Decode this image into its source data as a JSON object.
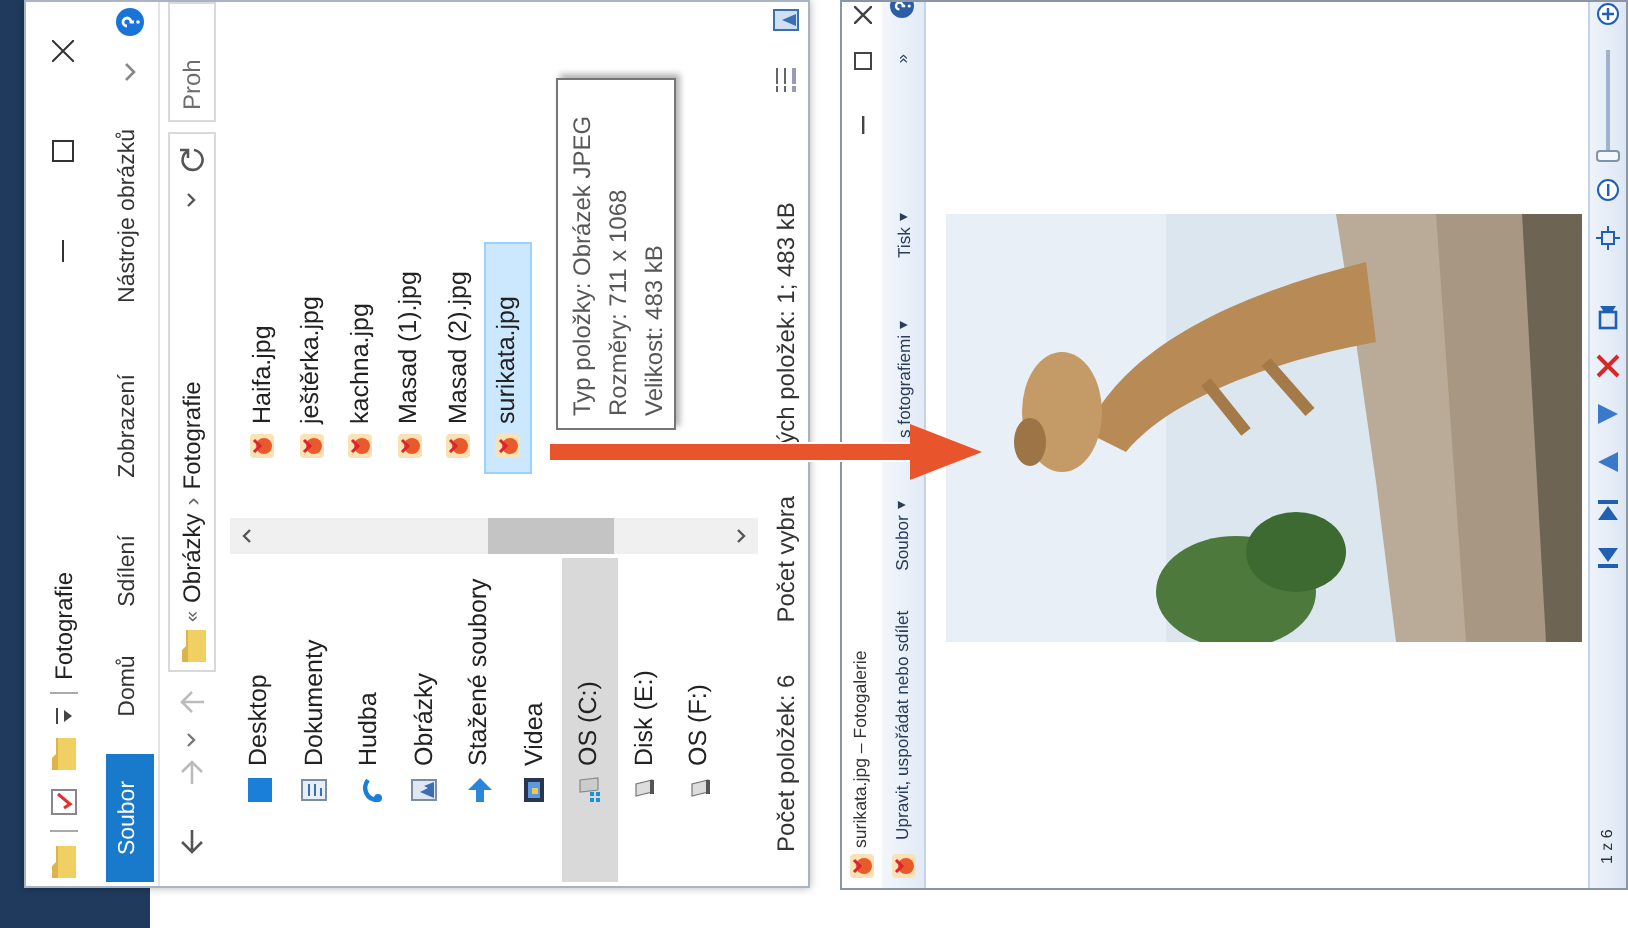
{
  "explorer": {
    "title": "Fotografie",
    "ribbon_tabs": [
      {
        "label": "Soubor",
        "selected": true
      },
      {
        "label": "Domů",
        "selected": false
      },
      {
        "label": "Sdílení",
        "selected": false
      },
      {
        "label": "Zobrazení",
        "selected": false
      },
      {
        "label": "Nástroje obrázků",
        "selected": false
      }
    ],
    "address": {
      "overflow": "«",
      "crumbs": [
        "Obrázky",
        "Fotografie"
      ],
      "separator": "›"
    },
    "search": {
      "placeholder": "Proh"
    },
    "nav": [
      {
        "label": "Desktop",
        "kind": "desktop",
        "selected": false
      },
      {
        "label": "Dokumenty",
        "kind": "documents",
        "selected": false
      },
      {
        "label": "Hudba",
        "kind": "music",
        "selected": false
      },
      {
        "label": "Obrázky",
        "kind": "pictures",
        "selected": false
      },
      {
        "label": "Stažené soubory",
        "kind": "downloads",
        "selected": false
      },
      {
        "label": "Videa",
        "kind": "videos",
        "selected": false
      },
      {
        "label": "OS (C:)",
        "kind": "system-drive",
        "selected": true
      },
      {
        "label": "Disk (E:)",
        "kind": "drive",
        "selected": false
      },
      {
        "label": "OS (F:)",
        "kind": "drive",
        "selected": false
      }
    ],
    "files": [
      {
        "name": "Haifa.jpg",
        "selected": false
      },
      {
        "name": "ještěrka.jpg",
        "selected": false
      },
      {
        "name": "kachna.jpg",
        "selected": false
      },
      {
        "name": "Masad (1).jpg",
        "selected": false
      },
      {
        "name": "Masad (2).jpg",
        "selected": false
      },
      {
        "name": "surikata.jpg",
        "selected": true
      }
    ],
    "tooltip": [
      "Typ položky: Obrázek JPEG",
      "Rozměry: 711 x 1068",
      "Velikost: 483 kB"
    ],
    "status": {
      "count": "Počet položek: 6",
      "selection": [
        "Počet vybra",
        "ých položek: 1; 483 kB"
      ]
    }
  },
  "gallery": {
    "title": "surikata.jpg – Fotogalerie",
    "menu": [
      {
        "label": "Upravit, uspořádat nebo sdílet",
        "dropdown": false
      },
      {
        "label": "Soubor",
        "dropdown": true
      },
      {
        "label": "s fotografiemi",
        "dropdown": true
      },
      {
        "label": "Tisk",
        "dropdown": true
      }
    ],
    "dropdown_mark": "▾",
    "overflow": "»",
    "position": "1 z 6",
    "zoom": {
      "level": 0
    }
  }
}
